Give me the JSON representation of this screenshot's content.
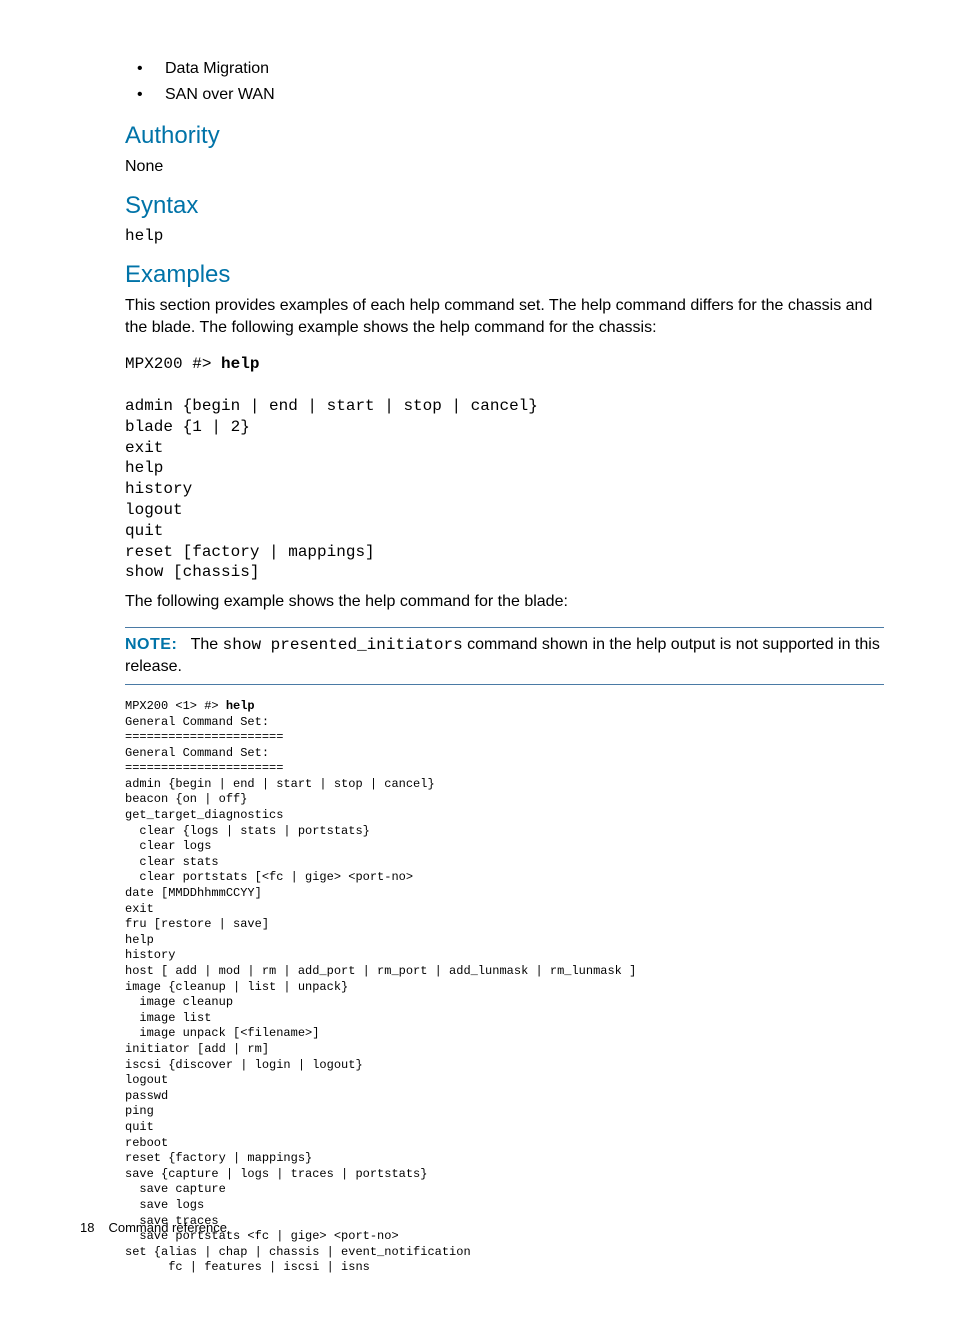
{
  "bullets": {
    "item1": "Data Migration",
    "item2": "SAN over WAN"
  },
  "sections": {
    "authority": {
      "title": "Authority",
      "body": "None"
    },
    "syntax": {
      "title": "Syntax",
      "code": "help"
    },
    "examples": {
      "title": "Examples",
      "intro": "This section provides examples of each help command set. The help command differs for the chassis and the blade. The following example shows the help command for the chassis:",
      "code1_prefix": "MPX200 #> ",
      "code1_cmd": "help",
      "code1_body": "admin {begin | end | start | stop | cancel}\nblade {1 | 2}\nexit\nhelp\nhistory\nlogout\nquit\nreset [factory | mappings]\nshow [chassis]",
      "mid_text": "The following example shows the help command for the blade:",
      "note_label": "NOTE:",
      "note_prefix": "The ",
      "note_mono": "show presented_initiators",
      "note_suffix": " command shown in the help output is not supported in this release.",
      "code2_prefix": "MPX200 <1> #> ",
      "code2_cmd": "help",
      "code2_body": "General Command Set:\n======================\nGeneral Command Set:\n======================\nadmin {begin | end | start | stop | cancel}\nbeacon {on | off}\nget_target_diagnostics\n  clear {logs | stats | portstats}\n  clear logs\n  clear stats\n  clear portstats [<fc | gige> <port-no>\ndate [MMDDhhmmCCYY]\nexit\nfru [restore | save]\nhelp\nhistory\nhost [ add | mod | rm | add_port | rm_port | add_lunmask | rm_lunmask ]\nimage {cleanup | list | unpack}\n  image cleanup\n  image list\n  image unpack [<filename>]\ninitiator [add | rm]\niscsi {discover | login | logout}\nlogout\npasswd\nping\nquit\nreboot\nreset {factory | mappings}\nsave {capture | logs | traces | portstats}\n  save capture\n  save logs\n  save traces\n  save portstats <fc | gige> <port-no>\nset {alias | chap | chassis | event_notification\n      fc | features | iscsi | isns"
    }
  },
  "footer": {
    "page": "18",
    "title": "Command reference"
  }
}
